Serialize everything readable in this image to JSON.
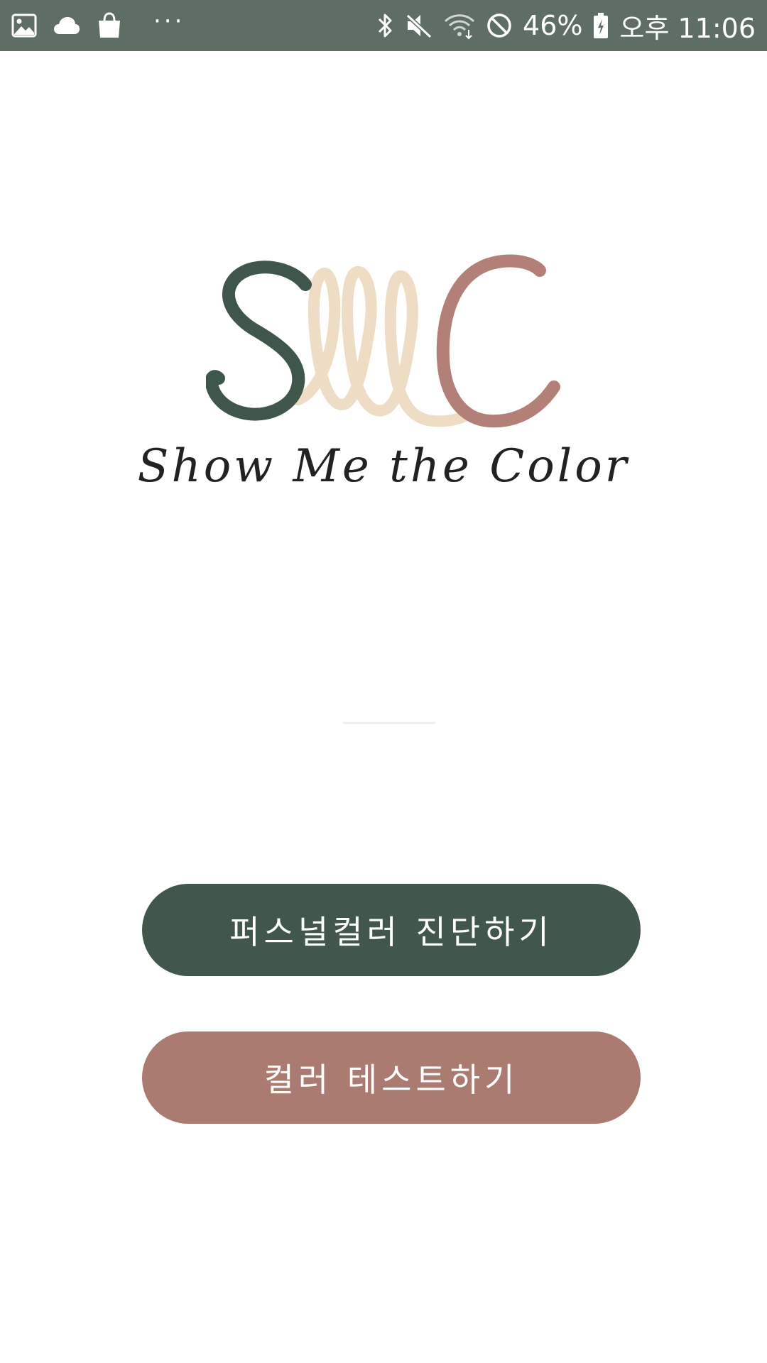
{
  "status_bar": {
    "left_icons": [
      "gallery-icon",
      "cloud-icon",
      "shopping-bag-icon"
    ],
    "more_dots": "···",
    "right_icons": [
      "bluetooth-icon",
      "mute-icon",
      "wifi-icon",
      "do-not-disturb-icon"
    ],
    "battery_percent": "46%",
    "battery_icon": "battery-charging-icon",
    "time": "오후 11:06",
    "background_color": "#5f6e65"
  },
  "logo": {
    "mark_text": "SMC",
    "tagline": "Show Me the Color",
    "colors": {
      "s": "#3f574a",
      "m": "#efdcc4",
      "c": "#b38078"
    }
  },
  "actions": {
    "personal_color_label": "퍼스널컬러 진단하기",
    "color_test_label": "컬러 테스트하기",
    "primary_color": "#42574c",
    "secondary_color": "#ab7b71"
  }
}
